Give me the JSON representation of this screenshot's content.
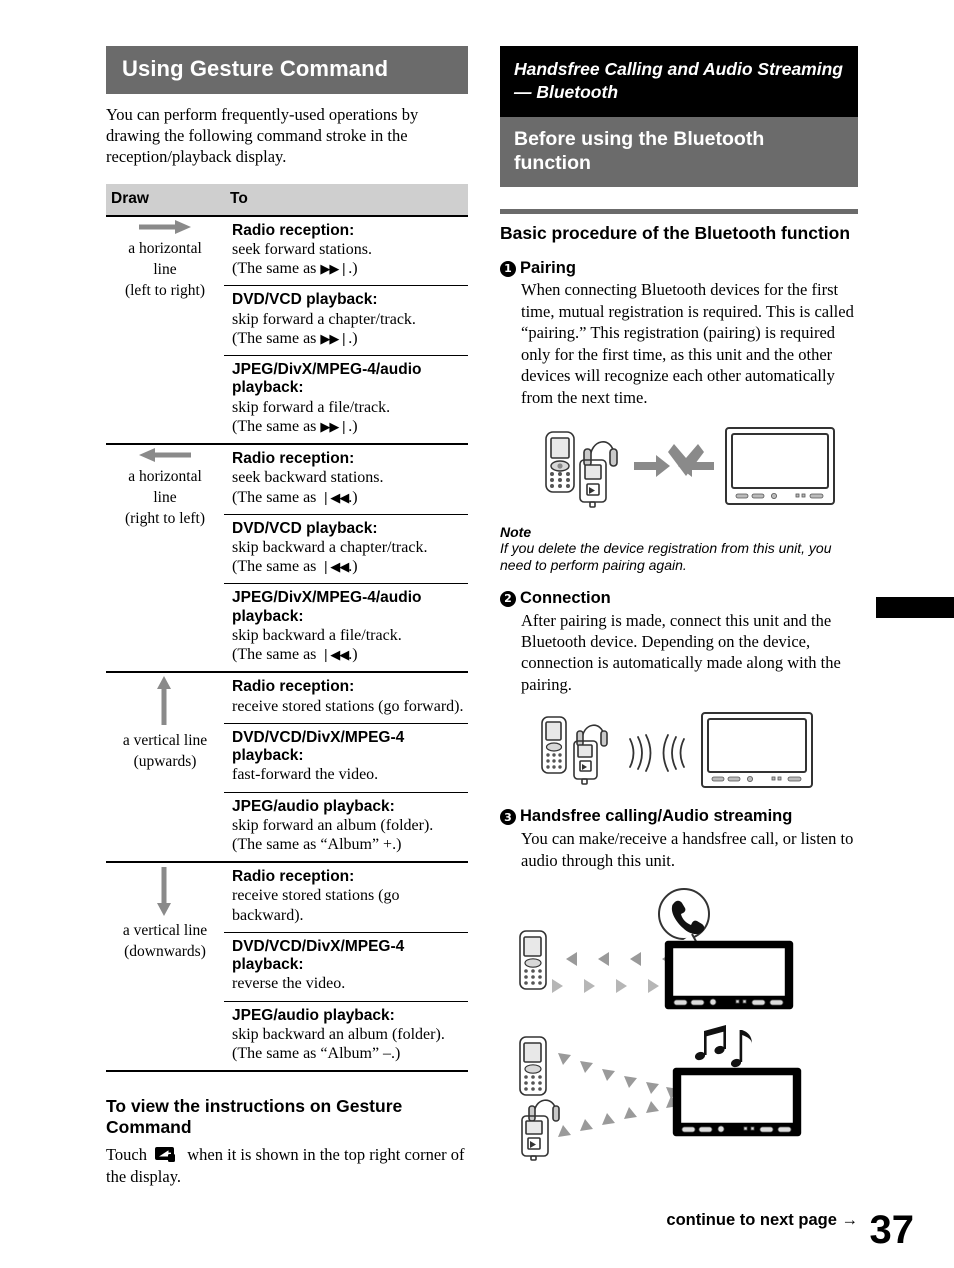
{
  "page": {
    "number": "37",
    "continue_label": "continue to next page",
    "continue_arrow": "→"
  },
  "left_column": {
    "section_title": "Using Gesture Command",
    "intro": "You can perform frequently-used operations by drawing the following command stroke in the reception/playback display.",
    "table": {
      "headers": {
        "draw": "Draw",
        "to": "To"
      },
      "rows": [
        {
          "icon": "arrow-right-icon",
          "draw_label_line1": "a horizontal",
          "draw_label_line2": "line",
          "draw_label_line3": "(left to right)",
          "items": [
            {
              "title": "Radio reception:",
              "desc": "seek forward stations.",
              "same_as": "(The same as",
              "glyph": "▶▶❘",
              "same_as_end": ".)"
            },
            {
              "title": "DVD/VCD playback:",
              "desc": "skip forward a chapter/track.",
              "same_as": "(The same as",
              "glyph": "▶▶❘",
              "same_as_end": ".)"
            },
            {
              "title": "JPEG/DivX/MPEG-4/audio playback:",
              "desc": "skip forward a file/track.",
              "same_as": "(The same as",
              "glyph": "▶▶❘",
              "same_as_end": ".)"
            }
          ]
        },
        {
          "icon": "arrow-left-icon",
          "draw_label_line1": "a horizontal",
          "draw_label_line2": "line",
          "draw_label_line3": "(right to left)",
          "items": [
            {
              "title": "Radio reception:",
              "desc": "seek backward stations.",
              "same_as": "(The same as",
              "glyph": "❘◀◀",
              "same_as_end": ".)"
            },
            {
              "title": "DVD/VCD playback:",
              "desc": "skip backward a chapter/track.",
              "same_as": "(The same as",
              "glyph": "❘◀◀",
              "same_as_end": ".)"
            },
            {
              "title": "JPEG/DivX/MPEG-4/audio playback:",
              "desc": "skip backward a file/track.",
              "same_as": "(The same as",
              "glyph": "❘◀◀",
              "same_as_end": ".)"
            }
          ]
        },
        {
          "icon": "arrow-up-icon",
          "draw_label_line1": "a vertical line",
          "draw_label_line2": "(upwards)",
          "draw_label_line3": "",
          "items": [
            {
              "title": "Radio reception:",
              "desc": "receive stored stations (go forward).",
              "same_as": "",
              "glyph": "",
              "same_as_end": ""
            },
            {
              "title": "DVD/VCD/DivX/MPEG-4 playback:",
              "desc": "fast-forward the video.",
              "same_as": "",
              "glyph": "",
              "same_as_end": ""
            },
            {
              "title": "JPEG/audio playback:",
              "desc": "skip forward an album (folder).",
              "same_as": "(The same as “Album” +.)",
              "glyph": "",
              "same_as_end": ""
            }
          ]
        },
        {
          "icon": "arrow-down-icon",
          "draw_label_line1": "a vertical line",
          "draw_label_line2": "(downwards)",
          "draw_label_line3": "",
          "items": [
            {
              "title": "Radio reception:",
              "desc": "receive stored stations (go backward).",
              "same_as": "",
              "glyph": "",
              "same_as_end": ""
            },
            {
              "title": "DVD/VCD/DivX/MPEG-4 playback:",
              "desc": "reverse the video.",
              "same_as": "",
              "glyph": "",
              "same_as_end": ""
            },
            {
              "title": "JPEG/audio playback:",
              "desc": "skip backward an album (folder).",
              "same_as": "(The same as “Album” –.)",
              "glyph": "",
              "same_as_end": ""
            }
          ]
        }
      ]
    },
    "view_instructions": {
      "heading": "To view the instructions on Gesture Command",
      "text_before": "Touch",
      "text_after": "when it is shown in the top right corner of the display."
    }
  },
  "right_column": {
    "chapter_title": "Handsfree Calling and Audio Streaming — Bluetooth",
    "section_title": "Before using the Bluetooth function",
    "sub_title": "Basic procedure of the Bluetooth function",
    "steps": [
      {
        "num": "1",
        "title": "Pairing",
        "body": "When connecting Bluetooth devices for the first time, mutual registration is required. This is called “pairing.” This registration (pairing) is required only for the first time, as this unit and the other devices will recognize each other automatically from the next time."
      },
      {
        "num": "2",
        "title": "Connection",
        "body": "After pairing is made, connect this unit and the Bluetooth device. Depending on the device, connection is automatically made along with the pairing."
      },
      {
        "num": "3",
        "title": "Handsfree calling/Audio streaming",
        "body": "You can make/receive a handsfree call, or listen to audio through this unit."
      }
    ],
    "note": {
      "label": "Note",
      "text": "If you delete the device registration from this unit, you need to perform pairing again."
    },
    "figures": [
      {
        "name": "pairing-diagram",
        "alt": "mobile phone and audio player pairing with car head unit"
      },
      {
        "name": "connection-diagram",
        "alt": "mobile phone and audio player connecting wirelessly to car head unit"
      },
      {
        "name": "handsfree-call-diagram",
        "alt": "mobile phone exchanging call data with car head unit, phone icon balloon"
      },
      {
        "name": "audio-streaming-diagram",
        "alt": "mobile phone and audio player streaming audio to car head unit, music notes"
      }
    ]
  },
  "colors": {
    "heading_gray": "#6b6b6b",
    "heading_black": "#000000",
    "table_header_gray": "#cfcfcf",
    "arrow_gray": "#808080"
  }
}
